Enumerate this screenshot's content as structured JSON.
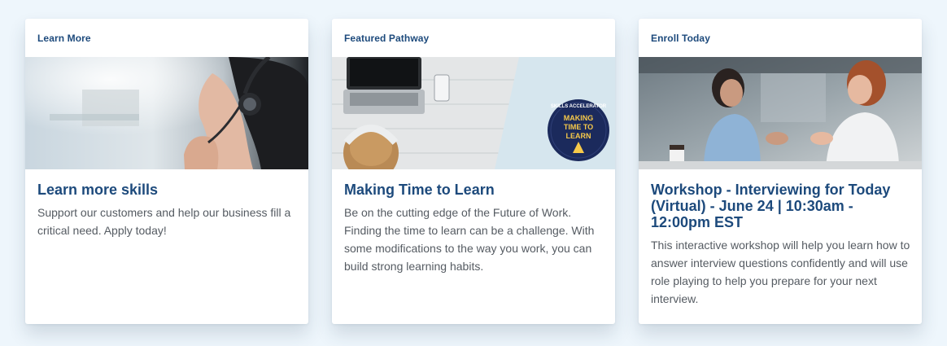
{
  "cards": [
    {
      "eyebrow": "Learn More",
      "title": "Learn more skills",
      "description": "Support our customers and help our business fill a critical need. Apply today!",
      "image": "customer-service-headset-photo"
    },
    {
      "eyebrow": "Featured Pathway",
      "title": "Making Time to Learn",
      "description": "Be on the cutting edge of the Future of Work. Finding the time to learn can be a challenge. With some modifications to the way you work, you can build strong learning habits.",
      "image": "laptop-desk-photo",
      "badge": {
        "ring_text": "SKILLS ACCELERATOR",
        "line1": "MAKING",
        "line2": "TIME TO",
        "line3": "LEARN"
      }
    },
    {
      "eyebrow": "Enroll Today",
      "title": "Workshop - Interviewing for Today (Virtual) - June 24 | 10:30am - 12:00pm EST",
      "description": "This interactive workshop will help you learn how to answer interview questions confidently and will use role playing to help you prepare for your next interview.",
      "image": "interview-meeting-photo"
    }
  ],
  "colors": {
    "background": "#eef6fc",
    "heading": "#1d4a7c",
    "body_text": "#555b62",
    "badge_navy": "#1b2a5c",
    "badge_yellow": "#f6c94a"
  }
}
